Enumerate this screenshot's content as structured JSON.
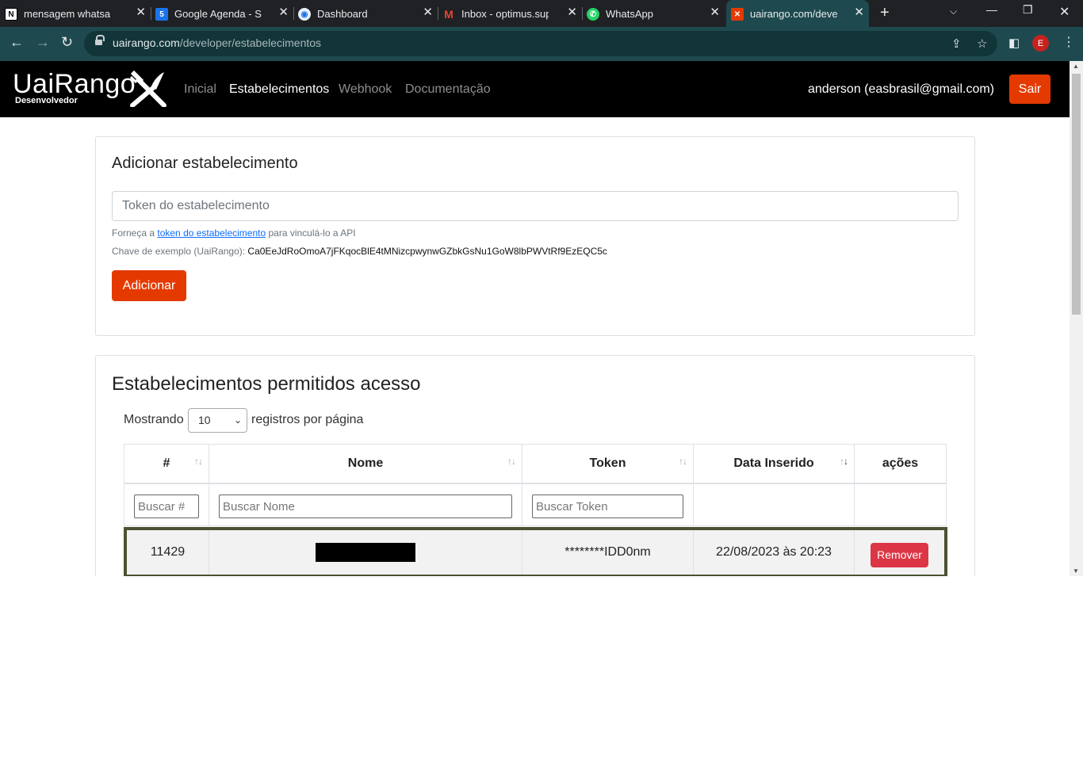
{
  "browser": {
    "tabs": [
      {
        "title": "mensagem whatsapp:",
        "favicon": "notion-icon",
        "active": false
      },
      {
        "title": "Google Agenda - Sem",
        "favicon": "google-calendar-icon",
        "active": false
      },
      {
        "title": "Dashboard",
        "favicon": "dashboard-icon",
        "active": false
      },
      {
        "title": "Inbox - optimus.supor",
        "favicon": "gmail-icon",
        "active": false
      },
      {
        "title": "WhatsApp",
        "favicon": "whatsapp-icon",
        "active": false
      },
      {
        "title": "uairango.com/develop",
        "favicon": "uairango-icon",
        "active": true
      }
    ],
    "url_host": "uairango.com",
    "url_path": "/developer/estabelecimentos",
    "profile_initial": "E"
  },
  "site": {
    "logo_main": "UaiRango",
    "logo_sub": "Desenvolvedor",
    "nav": [
      {
        "label": "Inicial",
        "active": false
      },
      {
        "label": "Estabelecimentos",
        "active": true
      },
      {
        "label": "Webhook",
        "active": false
      },
      {
        "label": "Documentação",
        "active": false
      }
    ],
    "user": "anderson (easbrasil@gmail.com)",
    "logout_label": "Sair"
  },
  "add_card": {
    "title": "Adicionar estabelecimento",
    "token_placeholder": "Token do estabelecimento",
    "help_prefix": "Forneça a ",
    "help_link": "token do estabelecimento",
    "help_suffix": " para vinculá-lo a API",
    "example_label": "Chave de exemplo (UaiRango): ",
    "example_key": "Ca0EeJdRoOmoA7jFKqocBlE4tMNizcpwynwGZbkGsNu1GoW8lbPWVtRf9EzEQC5c",
    "add_button": "Adicionar"
  },
  "list_card": {
    "title": "Estabelecimentos permitidos acesso",
    "showing_label": "Mostrando",
    "page_size": "10",
    "per_page_label": "registros por página",
    "columns": [
      "#",
      "Nome",
      "Token",
      "Data Inserido",
      "ações"
    ],
    "filters": {
      "id_placeholder": "Buscar #",
      "name_placeholder": "Buscar Nome",
      "token_placeholder": "Buscar Token"
    },
    "rows": [
      {
        "id": "11429",
        "nome": "",
        "token": "********IDD0nm",
        "data": "22/08/2023 às 20:23",
        "action": "Remover"
      }
    ]
  },
  "colors": {
    "accent": "#e43a00",
    "danger": "#dc3545",
    "chrome_toolbar": "#1e4a4f",
    "navbar": "#000000"
  }
}
